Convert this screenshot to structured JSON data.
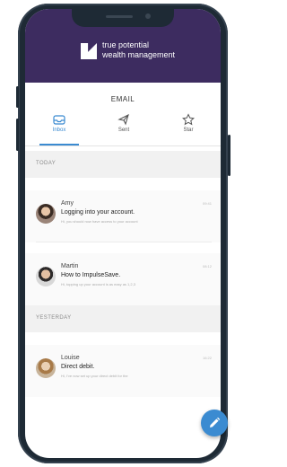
{
  "brand": {
    "line1": "true potential",
    "line2": "wealth management"
  },
  "screen_title": "EMAIL",
  "tabs": [
    {
      "label": "Inbox",
      "icon": "inbox-icon",
      "active": true
    },
    {
      "label": "Sent",
      "icon": "sent-icon",
      "active": false
    },
    {
      "label": "Star",
      "icon": "star-icon",
      "active": false
    }
  ],
  "sections": {
    "today": "TODAY",
    "yesterday": "YESTERDAY"
  },
  "messages": [
    {
      "sender": "Amy",
      "subject": "Logging into your account.",
      "preview": "Hi, you should now have access to your account",
      "time": "09:41"
    },
    {
      "sender": "Martin",
      "subject": "How to ImpulseSave.",
      "preview": "Hi, topping up your account is as easy as 1,2,3",
      "time": "08:12"
    },
    {
      "sender": "Louise",
      "subject": "Direct debit.",
      "preview": "Hi, I've now set up your direct debit for the",
      "time": "16:22"
    }
  ],
  "colors": {
    "header": "#3d2c60",
    "accent": "#3b8bd1",
    "phone_frame": "#1e2a35"
  },
  "fab": {
    "icon": "pencil-icon"
  }
}
